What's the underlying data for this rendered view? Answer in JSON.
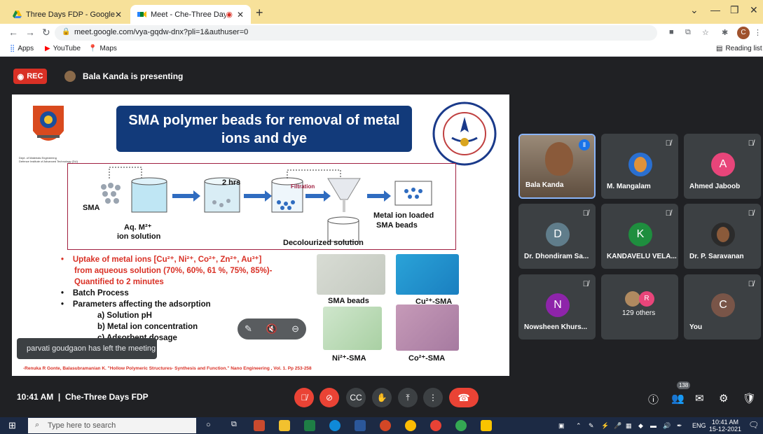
{
  "browser": {
    "tabs": [
      {
        "title": "Three Days FDP - Google Drive",
        "active": false
      },
      {
        "title": "Meet - Che-Three Days FDP",
        "active": true
      }
    ],
    "url": "meet.google.com/vya-gqdw-dnx?pli=1&authuser=0",
    "profile_initial": "C",
    "bookmarks": [
      "Apps",
      "YouTube",
      "Maps"
    ],
    "reading_list": "Reading list"
  },
  "meet": {
    "rec_label": "REC",
    "presenting_text": "Bala Kanda is presenting",
    "toast": "parvati goudgaon has left the meeting",
    "time": "10:41 AM",
    "separator": "|",
    "meeting_name": "Che-Three Days FDP",
    "participants_count": "138",
    "accent": "#8ab4f8",
    "danger": "#ea4335"
  },
  "slide": {
    "title_line1": "SMA polymer beads for removal of metal",
    "title_line2": "ions and dye",
    "labels": {
      "sma": "SMA",
      "aq_line1": "Aq. M²⁺",
      "aq_line2": "ion solution",
      "hrs": "2 hrs",
      "filtration": "Filtration",
      "loaded_line1": "Metal ion loaded",
      "loaded_line2": "SMA beads",
      "decolourized": "Decolourized solution"
    },
    "bullets": [
      {
        "text": "Uptake of metal ions [Cu²⁺, Ni²⁺, Co²⁺, Zn²⁺, Au³⁺]",
        "cont": [
          "from aqueous solution (70%, 60%, 61 %, 75%, 85%)-",
          "Quantified to 2 minutes"
        ],
        "color": "red"
      },
      {
        "text": "Batch Process",
        "color": "black"
      },
      {
        "text": "Parameters affecting the adsorption",
        "color": "black"
      }
    ],
    "sub_items": [
      "a) Solution pH",
      "b) Metal ion concentration",
      "c) Adsorbent dosage"
    ],
    "photo_captions": [
      "SMA beads",
      "Cu²⁺-SMA",
      "Ni²⁺-SMA",
      "Co²⁺-SMA"
    ],
    "reference": "-Renuka R Gonte, Balasubramanian K. \"Hollow Polymeric Structures- Synthesis and Function.\" Nano Engineering , Vol. 1. Pp 253-258",
    "logo_caption": "Dept. of Materials Engineering\nDefence Institute of Advanced Technology (DU)"
  },
  "participants": [
    {
      "name": "Bala Kanda",
      "type": "video",
      "speaking": true
    },
    {
      "name": "M. Mangalam",
      "type": "photo",
      "muted": true
    },
    {
      "name": "Ahmed Jaboob",
      "initial": "A",
      "color": "#e8457a",
      "muted": true
    },
    {
      "name": "Dr. Dhondiram Sa...",
      "initial": "D",
      "color": "#607d8b",
      "muted": true
    },
    {
      "name": "KANDAVELU VELA...",
      "initial": "K",
      "color": "#1e8e3e",
      "muted": true
    },
    {
      "name": "Dr. P. Saravanan",
      "type": "photo",
      "muted": true
    },
    {
      "name": "Nowsheen Khurs...",
      "initial": "N",
      "color": "#8e24aa",
      "muted": true
    },
    {
      "name": "129 others",
      "type": "others",
      "initial": "R"
    },
    {
      "name": "You",
      "initial": "C",
      "color": "#795548",
      "muted": true
    }
  ],
  "taskbar": {
    "search_placeholder": "Type here to search",
    "lang": "ENG",
    "time": "10:41 AM",
    "date": "15-12-2021"
  }
}
